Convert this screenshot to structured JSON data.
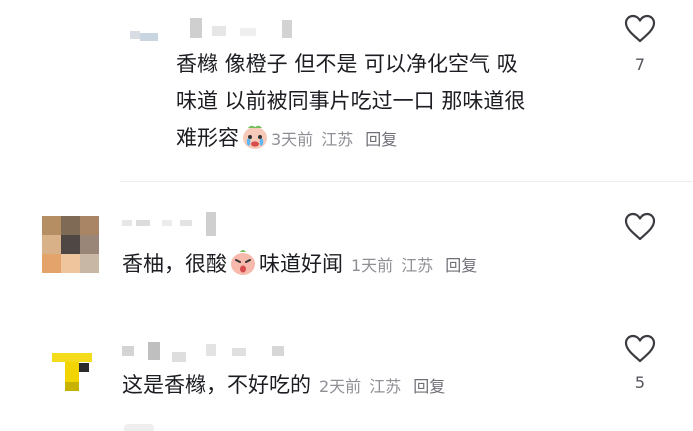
{
  "comments": [
    {
      "text": "香橼 像橙子 但不是 可以净化空气 吸味道 以前被同事片吃过一口 那味道很难形容",
      "lines": [
        "香橼 像橙子 但不是 可以净化空气 吸",
        "味道 以前被同事片吃过一口 那味道很",
        "难形容"
      ],
      "emoji": "crying-face-sticker",
      "time": "3天前",
      "location": "江苏",
      "reply_label": "回复",
      "like_count": "7"
    },
    {
      "text_before": "香柚，很酸",
      "text_after": "味道好闻",
      "emoji": "sour-face-sticker",
      "time": "1天前",
      "location": "江苏",
      "reply_label": "回复",
      "like_count": ""
    },
    {
      "text": "这是香橼，不好吃的",
      "time": "2天前",
      "location": "江苏",
      "reply_label": "回复",
      "like_count": "5"
    }
  ],
  "icons": {
    "like": "heart-outline-icon"
  },
  "colors": {
    "text": "#1c1d22",
    "meta": "#8f9096",
    "icon": "#3b3c42"
  }
}
